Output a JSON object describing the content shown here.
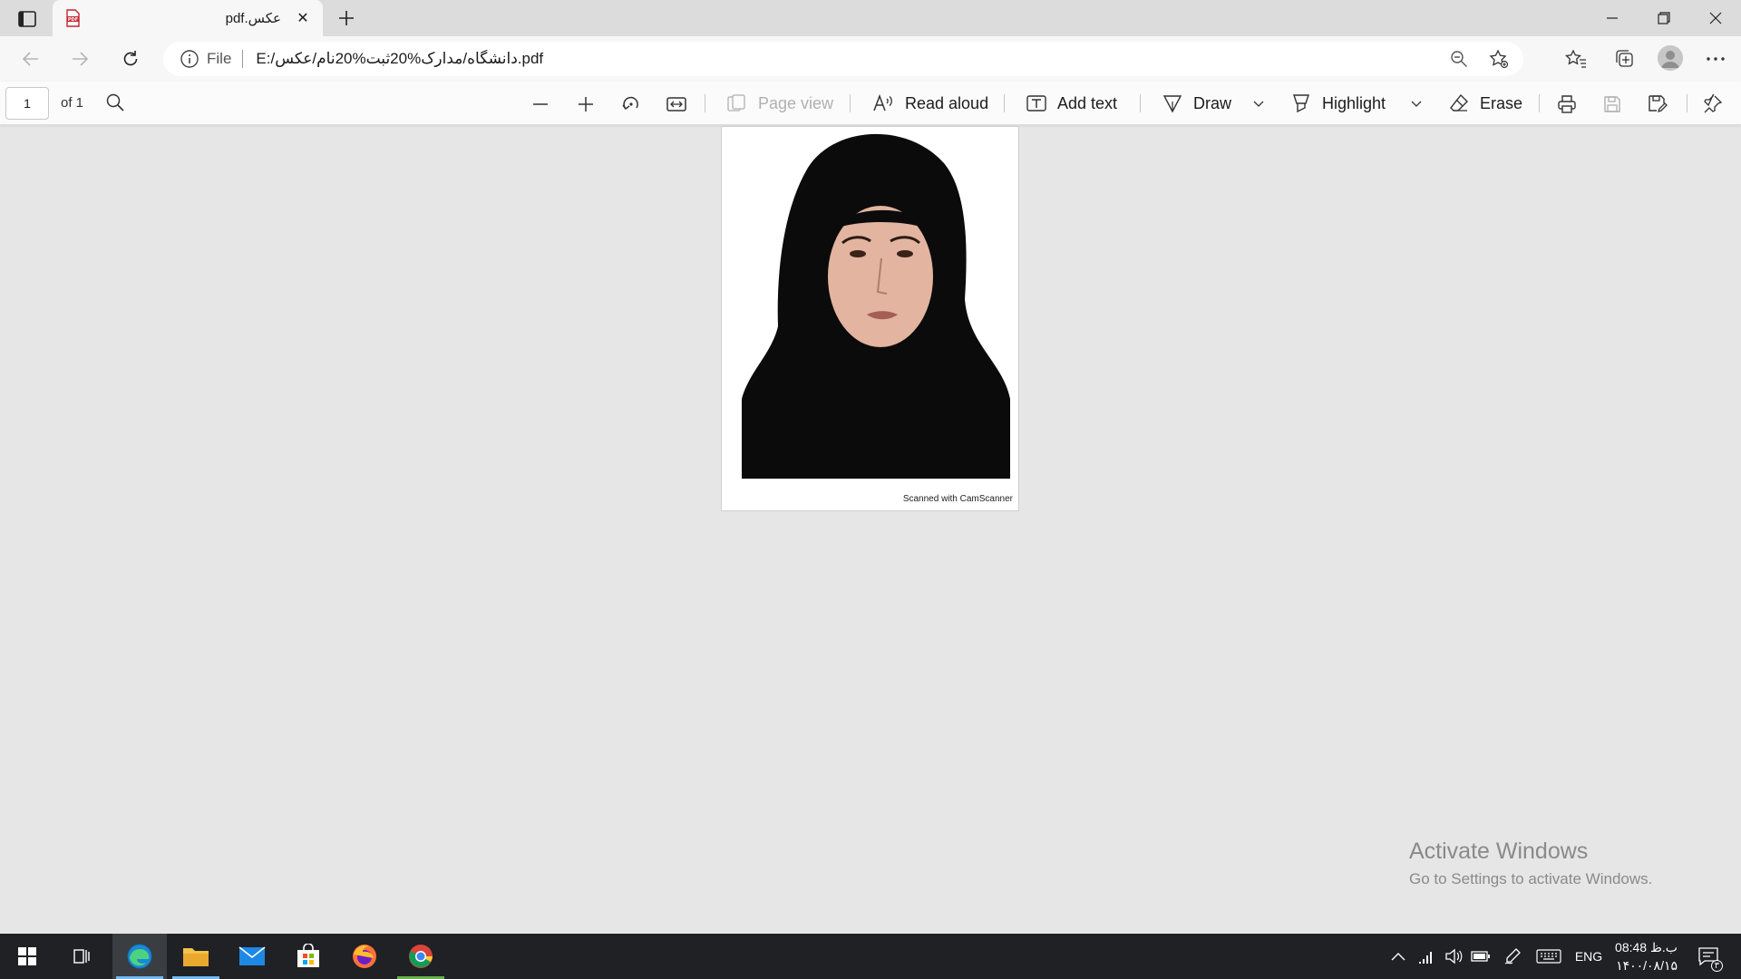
{
  "browser": {
    "tab": {
      "title": "pdf.عکس",
      "close_glyph": "✕"
    },
    "newtab_glyph": "+",
    "address": {
      "scheme": "File",
      "url": "E:/دانشگاه/مدارک%20ثبت%20نام/عکس.pdf"
    }
  },
  "pdf_toolbar": {
    "page_number": "1",
    "of_pages": "of 1",
    "page_view_label": "Page view",
    "read_aloud_label": "Read aloud",
    "add_text_label": "Add text",
    "draw_label": "Draw",
    "highlight_label": "Highlight",
    "erase_label": "Erase"
  },
  "document": {
    "footer_text": "Scanned with CamScanner"
  },
  "watermark": {
    "line1": "Activate Windows",
    "line2": "Go to Settings to activate Windows."
  },
  "taskbar": {
    "lang": "ENG",
    "time": "08:48 ب.ظ",
    "date": "۱۴۰۰/۰۸/۱۵",
    "notifications_count": "۳"
  },
  "colors": {
    "accent": "#0078d4",
    "taskbar_bg": "#1f2125"
  }
}
